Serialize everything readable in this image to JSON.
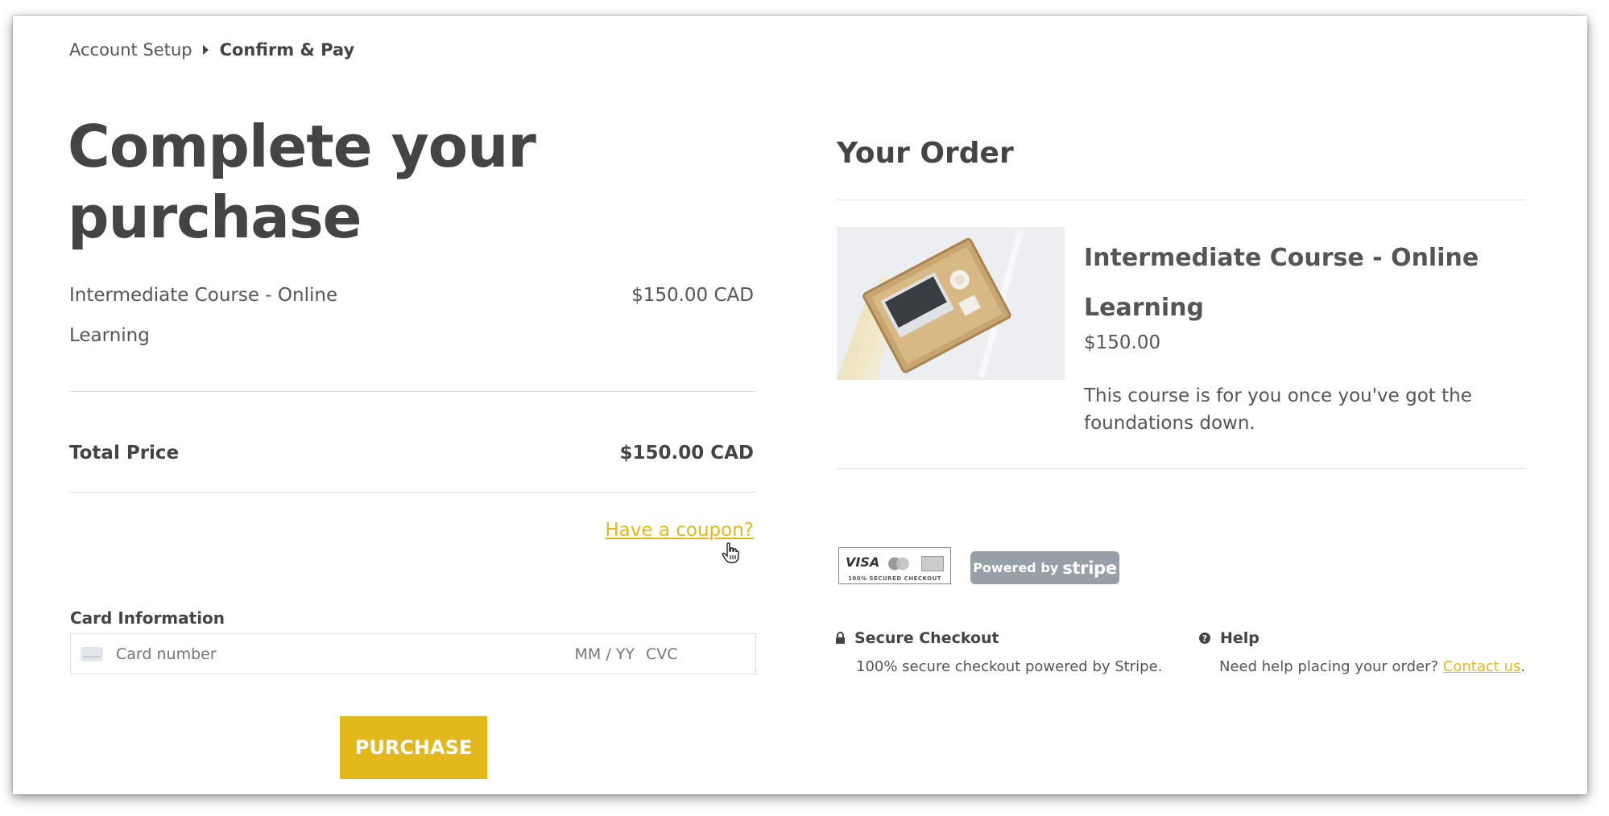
{
  "breadcrumb": {
    "step1": "Account Setup",
    "step2": "Confirm & Pay"
  },
  "page_title": "Complete your purchase",
  "line_item": {
    "name": "Intermediate Course - Online Learning",
    "price": "$150.00 CAD"
  },
  "total": {
    "label": "Total Price",
    "value": "$150.00 CAD"
  },
  "coupon_link": "Have a coupon?",
  "card": {
    "label": "Card Information",
    "number_placeholder": "Card number",
    "expiry_placeholder": "MM / YY",
    "cvc_placeholder": "CVC"
  },
  "purchase_button": "PURCHASE",
  "order": {
    "title": "Your Order",
    "product_name": "Intermediate Course - Online Learning",
    "product_price": "$150.00",
    "product_description": "This course is for you once you've got the foundations down."
  },
  "badges": {
    "visa": "VISA",
    "secured": "100% SECURED CHECKOUT",
    "powered_by": "Powered by",
    "stripe": "stripe"
  },
  "secure": {
    "title": "Secure Checkout",
    "text": "100% secure checkout powered by Stripe."
  },
  "help": {
    "title": "Help",
    "text": "Need help placing your order?",
    "link": "Contact us",
    "suffix": "."
  },
  "colors": {
    "accent": "#e3b81c",
    "text": "#444444",
    "stripe_badge": "#979fa7"
  },
  "icons": [
    "caret-right-icon",
    "card-icon",
    "lock-icon",
    "help-icon",
    "mastercard-icon",
    "hand-cursor-icon"
  ]
}
